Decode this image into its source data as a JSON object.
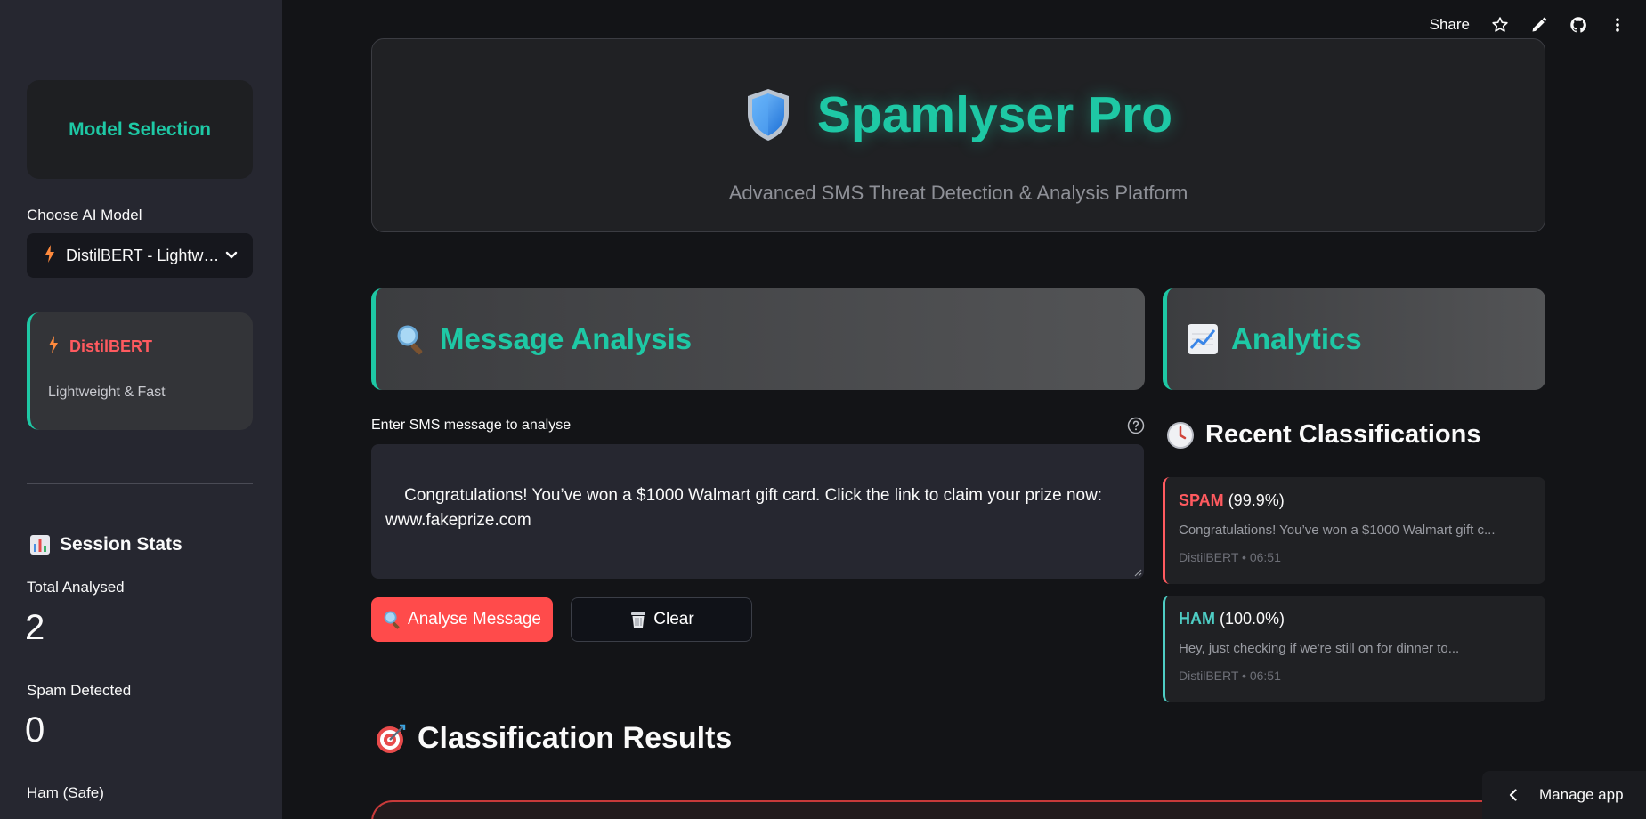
{
  "toolbar": {
    "share_label": "Share",
    "icons": [
      "star-icon",
      "edit-pencil-icon",
      "github-icon",
      "more-vert-icon"
    ]
  },
  "sidebar": {
    "model_card_title": "Model Selection",
    "choose_label": "Choose AI Model",
    "select_value": "DistilBERT - Lightweight & Fast",
    "select_icon": "bolt-icon",
    "info_card": {
      "title": "DistilBERT",
      "description": "Lightweight & Fast"
    },
    "session_stats": {
      "title": "Session Stats",
      "icon": "bar-chart-icon",
      "stats": [
        {
          "label": "Total Analysed",
          "value": "2"
        },
        {
          "label": "Spam Detected",
          "value": "0"
        },
        {
          "label": "Ham (Safe)",
          "value": ""
        }
      ]
    }
  },
  "header": {
    "title": "Spamlyser Pro",
    "subtitle": "Advanced SMS Threat Detection & Analysis Platform",
    "icon": "shield-icon"
  },
  "main": {
    "analysis_title": "Message Analysis",
    "analysis_icon": "magnifier-icon",
    "input_label": "Enter SMS message to analyse",
    "input_value": "Congratulations! You’ve won a $1000 Walmart gift card. Click the link to claim your prize now: www.fakeprize.com",
    "analyse_button": "Analyse Message",
    "clear_button": "Clear",
    "results_title": "Classification Results",
    "results_icon": "target-icon"
  },
  "analytics": {
    "title": "Analytics",
    "icon": "trend-chart-icon",
    "recent_title": "Recent Classifications",
    "recent_icon": "clock-icon",
    "recent": [
      {
        "label": "SPAM",
        "confidence": "(99.9%)",
        "message": "Congratulations! You’ve won a $1000 Walmart gift c...",
        "meta": "DistilBERT • 06:51",
        "color": "#ff5a5f"
      },
      {
        "label": "HAM",
        "confidence": "(100.0%)",
        "message": "Hey, just checking if we're still on for dinner to...",
        "meta": "DistilBERT • 06:51",
        "color": "#4ecdc4"
      }
    ]
  },
  "footer": {
    "manage_app_label": "Manage app"
  },
  "colors": {
    "accent": "#1ec8a5",
    "danger": "#ff4b4b",
    "sidebar_bg": "#262730",
    "page_bg": "#131417"
  }
}
